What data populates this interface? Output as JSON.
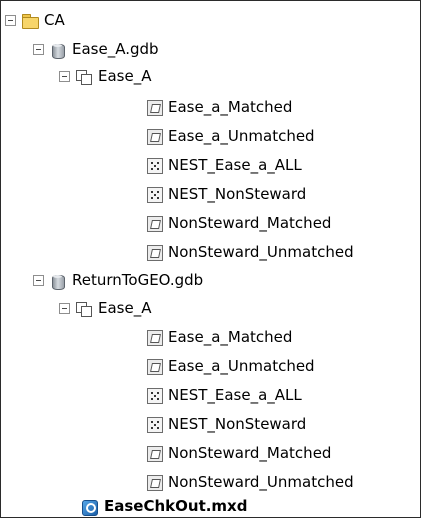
{
  "tree": {
    "root": {
      "label": "CA",
      "icon": "folder-icon"
    },
    "gdb1": {
      "label": "Ease_A.gdb",
      "icon": "geodatabase-icon",
      "dataset": {
        "label": "Ease_A",
        "icon": "feature-dataset-icon",
        "items": [
          {
            "label": "Ease_a_Matched",
            "icon": "polygon-feature-class-icon"
          },
          {
            "label": "Ease_a_Unmatched",
            "icon": "polygon-feature-class-icon"
          },
          {
            "label": "NEST_Ease_a_ALL",
            "icon": "point-feature-class-icon"
          },
          {
            "label": "NEST_NonSteward",
            "icon": "point-feature-class-icon"
          },
          {
            "label": "NonSteward_Matched",
            "icon": "polygon-feature-class-icon"
          },
          {
            "label": "NonSteward_Unmatched",
            "icon": "polygon-feature-class-icon"
          }
        ]
      }
    },
    "gdb2": {
      "label": "ReturnToGEO.gdb",
      "icon": "geodatabase-icon",
      "dataset": {
        "label": "Ease_A",
        "icon": "feature-dataset-icon",
        "items": [
          {
            "label": "Ease_a_Matched",
            "icon": "polygon-feature-class-icon"
          },
          {
            "label": "Ease_a_Unmatched",
            "icon": "polygon-feature-class-icon"
          },
          {
            "label": "NEST_Ease_a_ALL",
            "icon": "point-feature-class-icon"
          },
          {
            "label": "NEST_NonSteward",
            "icon": "point-feature-class-icon"
          },
          {
            "label": "NonSteward_Matched",
            "icon": "polygon-feature-class-icon"
          },
          {
            "label": "NonSteward_Unmatched",
            "icon": "polygon-feature-class-icon"
          }
        ]
      }
    },
    "mxd": {
      "label": "EaseChkOut.mxd",
      "icon": "map-document-icon"
    }
  }
}
